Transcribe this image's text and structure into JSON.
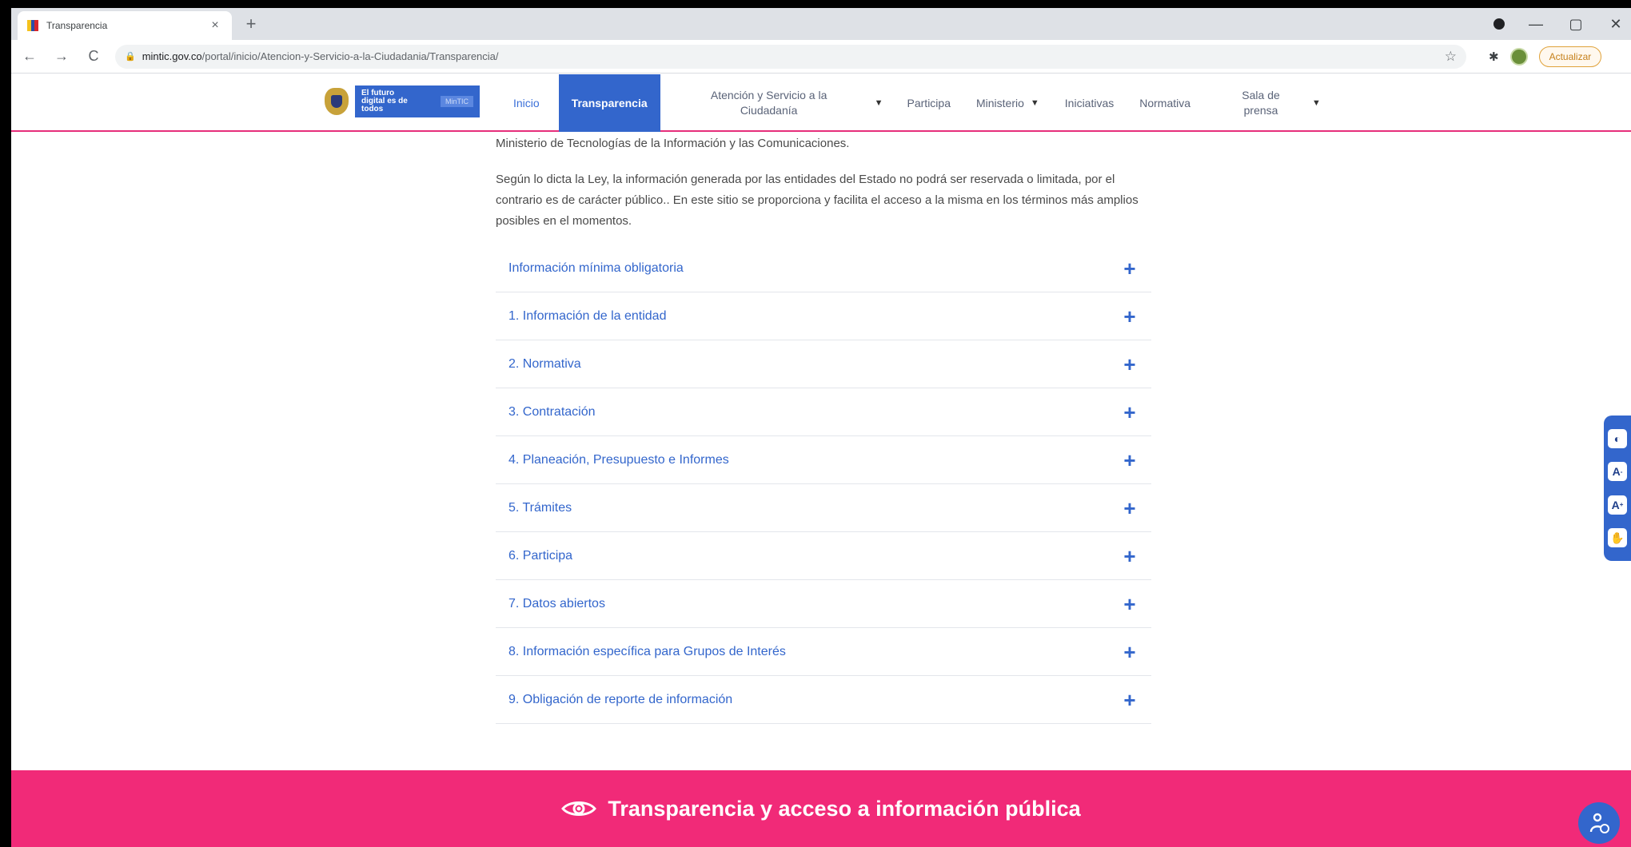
{
  "browser": {
    "tab_title": "Transparencia",
    "tab_close": "×",
    "new_tab": "+",
    "url_host": "mintic.gov.co",
    "url_path": "/portal/inicio/Atencion-y-Servicio-a-la-Ciudadania/Transparencia/",
    "update_label": "Actualizar",
    "back": "←",
    "forward": "→",
    "reload": "C",
    "minimize": "—",
    "restore": "▢",
    "close": "✕"
  },
  "header": {
    "banner_text": "El futuro digital es de todos",
    "banner_tag": "MinTIC",
    "nav": {
      "inicio": "Inicio",
      "transparencia": "Transparencia",
      "atencion": "Atención y Servicio a la Ciudadanía",
      "participa": "Participa",
      "ministerio": "Ministerio",
      "iniciativas": "Iniciativas",
      "normativa": "Normativa",
      "sala": "Sala de prensa"
    }
  },
  "content": {
    "intro_line": "Ministerio de Tecnologías de la Información y las Comunicaciones.",
    "intro_para": "Según lo dicta la Ley, la información generada por las entidades del Estado no podrá ser reservada o limitada, por el contrario es de carácter público.. En este sitio se proporciona y facilita el acceso a la misma en los términos más amplios posibles en el momentos.",
    "accordion": [
      "Información mínima obligatoria",
      "1. Información de la entidad",
      "2. Normativa",
      "3. Contratación",
      "4. Planeación, Presupuesto e Informes",
      "5. Trámites",
      "6. Participa",
      "7. Datos abiertos",
      "8. Información específica para Grupos de Interés",
      "9. Obligación de reporte de información"
    ],
    "plus": "+"
  },
  "footer": {
    "banner_text": "Transparencia y acceso a información pública"
  },
  "colors": {
    "brand_blue": "#3366cc",
    "accent_pink": "#f12a78"
  }
}
